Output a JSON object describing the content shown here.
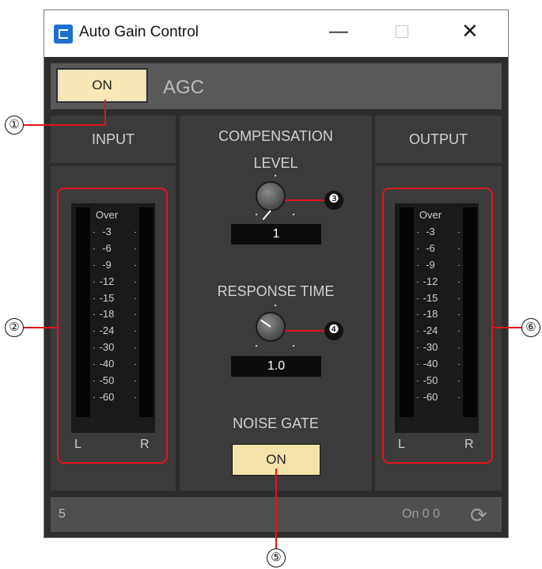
{
  "window": {
    "title": "Auto Gain Control",
    "icon": "app-logo-icon",
    "controls": {
      "minimize": "—",
      "maximize": "",
      "close": "✕"
    }
  },
  "header": {
    "on_button": "ON",
    "label": "AGC"
  },
  "input": {
    "title": "INPUT",
    "scale": [
      "Over",
      "-3",
      "-6",
      "-9",
      "-12",
      "-15",
      "-18",
      "-24",
      "-30",
      "-40",
      "-50",
      "-60"
    ],
    "left": "L",
    "right": "R"
  },
  "output": {
    "title": "OUTPUT",
    "scale": [
      "Over",
      "-3",
      "-6",
      "-9",
      "-12",
      "-15",
      "-18",
      "-24",
      "-30",
      "-40",
      "-50",
      "-60"
    ],
    "left": "L",
    "right": "R"
  },
  "center": {
    "compensation_title": "COMPENSATION",
    "level_label": "LEVEL",
    "level_value": "1",
    "response_label": "RESPONSE TIME",
    "response_value": "1.0",
    "noise_gate_label": "NOISE GATE",
    "noise_gate_button": "ON"
  },
  "footer": {
    "left": "5",
    "right": "On 0 0",
    "icon": "refresh-icon"
  },
  "callouts": [
    "①",
    "②",
    "❸",
    "❹",
    "⑤",
    "⑥"
  ],
  "colors": {
    "accent_red": "#e0141e",
    "button_yellow": "#f7e8b5",
    "panel": "#3b3b3b"
  }
}
